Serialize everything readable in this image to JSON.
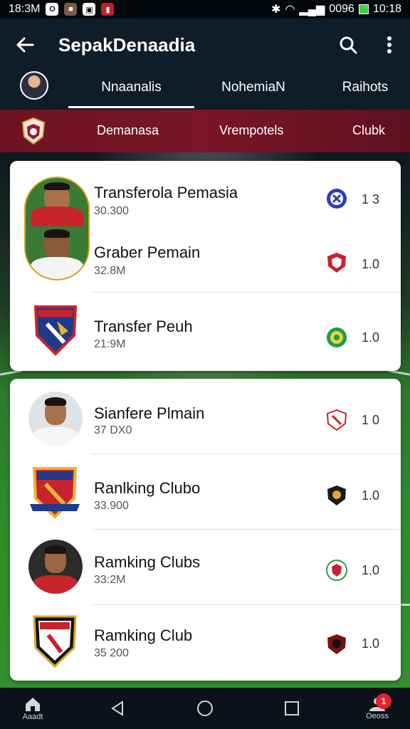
{
  "status_bar": {
    "time_left": "18:3M",
    "network": "0096",
    "time_right": "10:18"
  },
  "app_bar": {
    "title": "SepakDenaadia"
  },
  "tabs": [
    {
      "label": "Nnaanalis",
      "active": true
    },
    {
      "label": "NohemiaN",
      "active": false
    },
    {
      "label": "Raihots",
      "active": false
    }
  ],
  "club_bar": {
    "items": [
      "Demanasa",
      "Vrempotels",
      "Clubk"
    ]
  },
  "card1": {
    "rows": [
      {
        "name": "Transferola Pemasia",
        "sub": "30.300",
        "value": "1 3",
        "icon": "player-photo"
      },
      {
        "name": "Graber Pemain",
        "sub": "32.8M",
        "value": "1.0",
        "icon": "player-photo"
      },
      {
        "name": "Transfer Peuh",
        "sub": "21:9M",
        "value": "1.0",
        "icon": "club-crest"
      }
    ]
  },
  "card2": {
    "rows": [
      {
        "name": "Sianfere Plmain",
        "sub": "37 DX0",
        "value": "1 0",
        "icon": "player-photo"
      },
      {
        "name": "Ranlking Clubo",
        "sub": "33.900",
        "value": "1.0",
        "icon": "club-crest"
      },
      {
        "name": "Ramking Clubs",
        "sub": "33:2M",
        "value": "1.0",
        "icon": "player-photo"
      },
      {
        "name": "Ramking Club",
        "sub": "35 200",
        "value": "1.0",
        "icon": "club-crest"
      }
    ]
  },
  "nav": {
    "home_label": "Aaadt",
    "profile_label": "Oeoss",
    "badge_count": "1"
  },
  "colors": {
    "app_bar": "#0e1d28",
    "club_bar": "#7a1626",
    "card": "#ffffff",
    "badge": "#e0232f"
  }
}
